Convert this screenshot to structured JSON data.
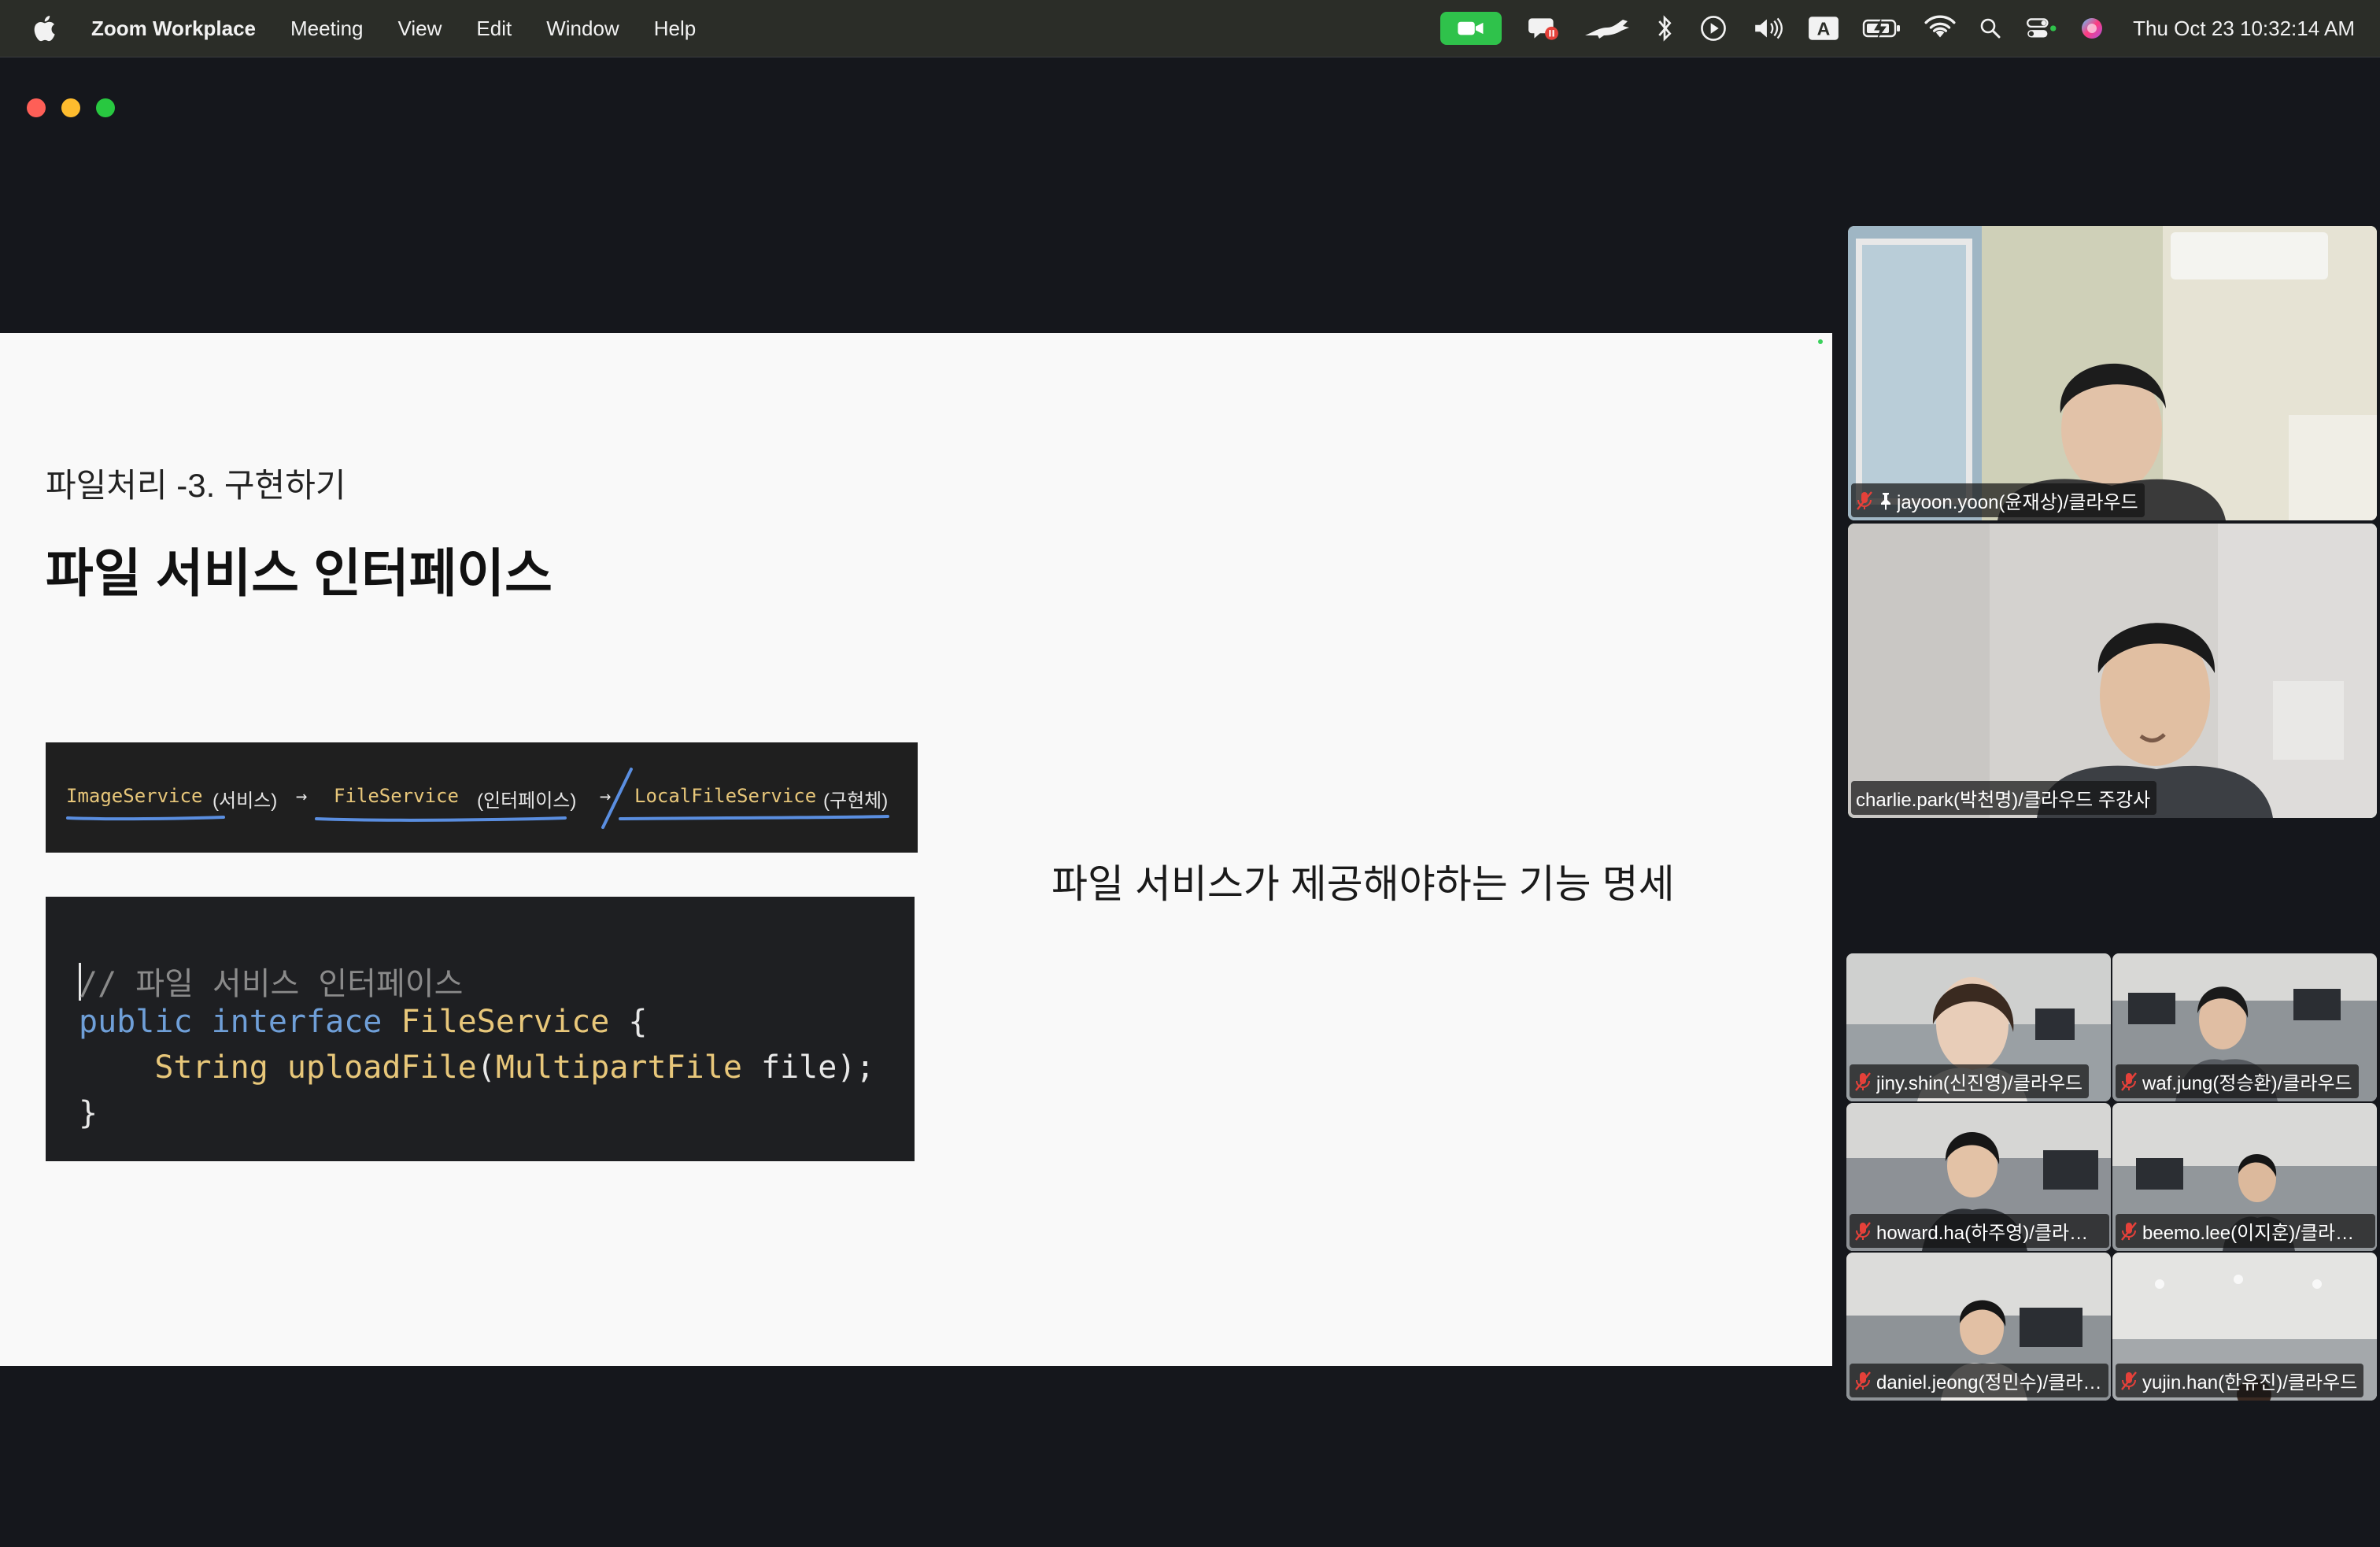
{
  "menubar": {
    "app_name": "Zoom Workplace",
    "menus": [
      "Meeting",
      "View",
      "Edit",
      "Window",
      "Help"
    ],
    "clock": "Thu Oct 23  10:32:14 AM",
    "input_source": "A",
    "status_icons": [
      "zoom-video-icon",
      "chat-bubble-icon",
      "dragon-icon",
      "bluetooth-icon",
      "play-icon",
      "volume-icon",
      "input-source-icon",
      "battery-icon",
      "wifi-icon",
      "search-icon",
      "control-center-icon",
      "siri-icon"
    ]
  },
  "slide": {
    "subtitle": "파일처리 -3. 구현하기",
    "title": "파일 서비스 인터페이스",
    "flow": {
      "item1_code": "ImageService",
      "item1_kor": "(서비스)",
      "item2_code": "FileService",
      "item2_kor": "(인터페이스)",
      "item3_code": "LocalFileService",
      "item3_kor": "(구현체)",
      "arrow": "→"
    },
    "code": {
      "comment": "// 파일 서비스 인터페이스",
      "kw_public": "public",
      "kw_interface": "interface",
      "type_fileservice": "FileService",
      "brace_open": " {",
      "type_string": "String",
      "method": "uploadFile",
      "paren_open": "(",
      "type_multipart": "MultipartFile",
      "param": " file);",
      "brace_close": "}"
    },
    "note": "파일 서비스가 제공해야하는 기능 명세"
  },
  "participants": [
    {
      "name": "jayoon.yoon(윤재상)/클라우드",
      "muted": true,
      "pinned": true
    },
    {
      "name": "charlie.park(박천명)/클라우드 주강사",
      "muted": false,
      "active_speaker": true
    },
    {
      "name": "jiny.shin(신진영)/클라우드",
      "muted": true
    },
    {
      "name": "waf.jung(정승환)/클라우드",
      "muted": true
    },
    {
      "name": "howard.ha(하주영)/클라우드",
      "muted": true
    },
    {
      "name": "beemo.lee(이지훈)/클라우드",
      "muted": true
    },
    {
      "name": "daniel.jeong(정민수)/클라…",
      "muted": true
    },
    {
      "name": "yujin.han(한유진)/클라우드",
      "muted": true
    }
  ],
  "colors": {
    "menubar_bg": "#2b2d28",
    "window_bg": "#15171c",
    "active_speaker_border": "#32c75a",
    "mute_red": "#e5413a",
    "zoom_green": "#2fc24b"
  }
}
